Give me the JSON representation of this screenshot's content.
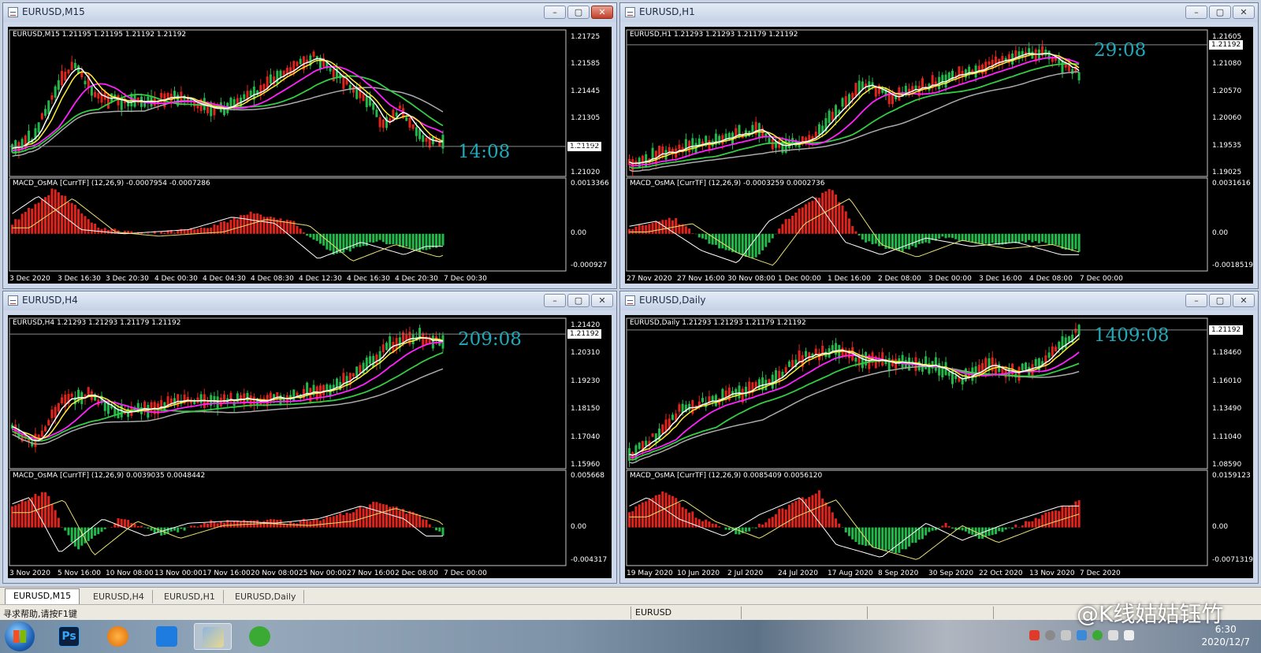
{
  "windows": [
    {
      "id": "m15",
      "title": "EURUSD,M15",
      "info": "EURUSD,M15  1.21195 1.21195 1.21192 1.21192",
      "countdown": "14:08",
      "price_label": "1.21192",
      "price_ticks": [
        "1.21725",
        "1.21585",
        "1.21445",
        "1.21305",
        "1.21160",
        "1.21020"
      ],
      "macd_info": "MACD_OsMA [CurrTF] (12,26,9) -0.0007954 -0.0007286",
      "macd_ticks": [
        "0.0013366",
        "0.00",
        "-0.000927"
      ],
      "time_ticks": [
        "3 Dec 2020",
        "3 Dec 16:30",
        "3 Dec 20:30",
        "4 Dec 00:30",
        "4 Dec 04:30",
        "4 Dec 08:30",
        "4 Dec 12:30",
        "4 Dec 16:30",
        "4 Dec 20:30",
        "7 Dec 00:30"
      ],
      "close_active": true
    },
    {
      "id": "h1",
      "title": "EURUSD,H1",
      "info": "EURUSD,H1  1.21293 1.21293 1.21179 1.21192",
      "countdown": "29:08",
      "price_label": "1.21192",
      "price_ticks": [
        "1.21605",
        "1.21080",
        "1.20570",
        "1.20060",
        "1.19535",
        "1.19025"
      ],
      "macd_info": "MACD_OsMA [CurrTF] (12,26,9) -0.0003259 0.0002736",
      "macd_ticks": [
        "0.0031616",
        "0.00",
        "-0.0018519"
      ],
      "time_ticks": [
        "27 Nov 2020",
        "27 Nov 16:00",
        "30 Nov 08:00",
        "1 Dec 00:00",
        "1 Dec 16:00",
        "2 Dec 08:00",
        "3 Dec 00:00",
        "3 Dec 16:00",
        "4 Dec 08:00",
        "7 Dec 00:00"
      ],
      "close_active": false
    },
    {
      "id": "h4",
      "title": "EURUSD,H4",
      "info": "EURUSD,H4  1.21293 1.21293 1.21179 1.21192",
      "countdown": "209:08",
      "price_label": "1.21192",
      "price_ticks": [
        "1.21420",
        "1.20310",
        "1.19230",
        "1.18150",
        "1.17040",
        "1.15960"
      ],
      "macd_info": "MACD_OsMA [CurrTF] (12,26,9) 0.0039035 0.0048442",
      "macd_ticks": [
        "0.005668",
        "0.00",
        "-0.004317"
      ],
      "time_ticks": [
        "3 Nov 2020",
        "5 Nov 16:00",
        "10 Nov 08:00",
        "13 Nov 00:00",
        "17 Nov 16:00",
        "20 Nov 08:00",
        "25 Nov 00:00",
        "27 Nov 16:00",
        "2 Dec 08:00",
        "7 Dec 00:00"
      ],
      "close_active": false
    },
    {
      "id": "daily",
      "title": "EURUSD,Daily",
      "info": "EURUSD,Daily  1.21293 1.21293 1.21179 1.21192",
      "countdown": "1409:08",
      "price_label": "1.21192",
      "price_ticks": [
        "1.21192",
        "1.18460",
        "1.16010",
        "1.13490",
        "1.11040",
        "1.08590"
      ],
      "macd_info": "MACD_OsMA [CurrTF] (12,26,9) 0.0085409 0.0056120",
      "macd_ticks": [
        "0.0159123",
        "0.00",
        "-0.0071319"
      ],
      "time_ticks": [
        "19 May 2020",
        "10 Jun 2020",
        "2 Jul 2020",
        "24 Jul 2020",
        "17 Aug 2020",
        "8 Sep 2020",
        "30 Sep 2020",
        "22 Oct 2020",
        "13 Nov 2020",
        "7 Dec 2020"
      ],
      "close_active": false
    }
  ],
  "tabs": [
    "EURUSD,M15",
    "EURUSD,H4",
    "EURUSD,H1",
    "EURUSD,Daily"
  ],
  "status": {
    "help": "寻求帮助,请按F1键",
    "symbol": "EURUSD"
  },
  "taskbar": {
    "time": "6:30",
    "date": "2020/12/7",
    "ps_label": "Ps"
  },
  "watermark": "@K线姑姑钰竹",
  "colors": {
    "bull": "#22b84a",
    "bear": "#e0241c",
    "ma_fast": "#ffffff",
    "ma_yellow": "#ffee33",
    "ma_magenta": "#ff22ff",
    "ma_green": "#33cc44",
    "ma_gray": "#aaaaaa",
    "countdown": "#20a8b8"
  }
}
